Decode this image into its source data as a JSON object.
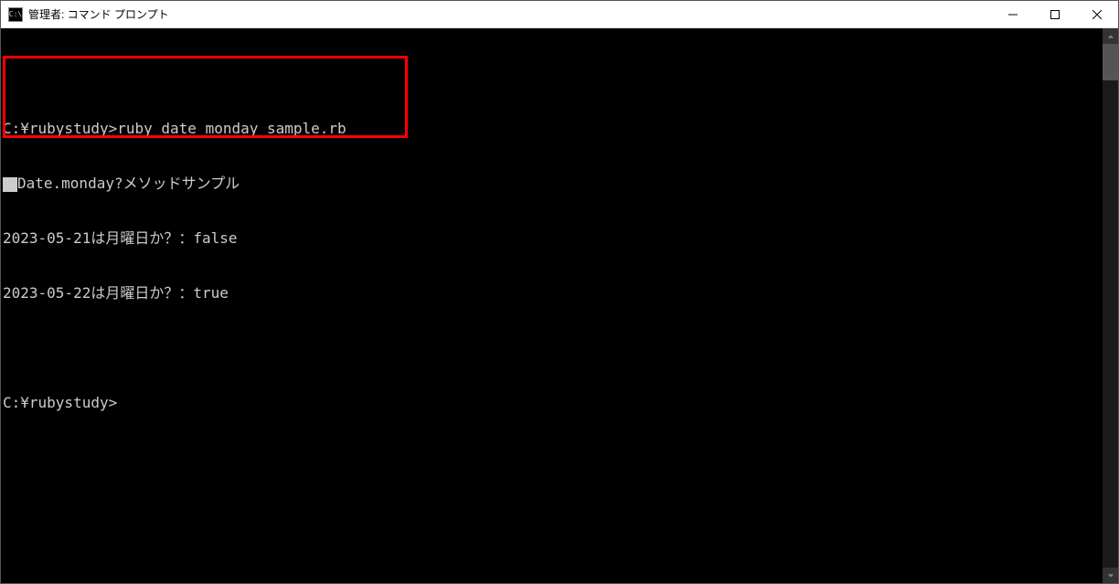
{
  "window": {
    "title": "管理者: コマンド プロンプト"
  },
  "console": {
    "line1_prompt": "C:¥rubystudy>",
    "line1_command": "ruby date_monday_sample.rb",
    "line2": "Date.monday?メソッドサンプル",
    "line3": "2023-05-21は月曜日か？：false",
    "line4": "2023-05-22は月曜日か？：true",
    "line5_prompt": "C:¥rubystudy>"
  }
}
